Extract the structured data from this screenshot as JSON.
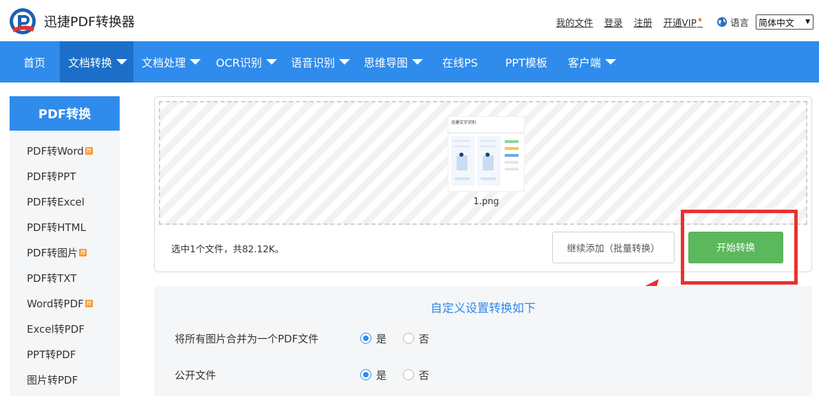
{
  "header": {
    "brand": "迅捷PDF转换器",
    "links": {
      "my_files": "我的文件",
      "login": "登录",
      "register": "注册",
      "vip": "开通VIP"
    },
    "language_label": "语言",
    "language_value": "简体中文"
  },
  "nav": {
    "items": [
      {
        "label": "首页"
      },
      {
        "label": "文档转换"
      },
      {
        "label": "文档处理"
      },
      {
        "label": "OCR识别"
      },
      {
        "label": "语音识别"
      },
      {
        "label": "思维导图"
      },
      {
        "label": "在线PS"
      },
      {
        "label": "PPT模板"
      },
      {
        "label": "客户端"
      }
    ],
    "active": "文档转换"
  },
  "sidebar": {
    "title": "PDF转换",
    "items": [
      {
        "label": "PDF转Word",
        "badge": "荐"
      },
      {
        "label": "PDF转PPT"
      },
      {
        "label": "PDF转Excel"
      },
      {
        "label": "PDF转HTML"
      },
      {
        "label": "PDF转图片",
        "badge": "荐"
      },
      {
        "label": "PDF转TXT"
      },
      {
        "label": "Word转PDF",
        "badge": "荐"
      },
      {
        "label": "Excel转PDF"
      },
      {
        "label": "PPT转PDF"
      },
      {
        "label": "图片转PDF"
      }
    ]
  },
  "upload": {
    "file_name": "1.png",
    "thumbnail_title": "迅捷文字识别",
    "file_info": "选中1个文件，共82.12K。",
    "add_button": "继续添加（批量转换）",
    "start_button": "开始转换"
  },
  "settings": {
    "title": "自定义设置转换如下",
    "options": [
      {
        "label": "将所有图片合并为一个PDF文件",
        "yes": "是",
        "no": "否",
        "selected": "是"
      },
      {
        "label": "公开文件",
        "yes": "是",
        "no": "否",
        "selected": "是"
      }
    ]
  },
  "colors": {
    "brand_blue": "#2f8bec",
    "nav_active": "#1c6fc8",
    "start_green": "#5cb85c",
    "annotation_red": "#e8322e"
  }
}
